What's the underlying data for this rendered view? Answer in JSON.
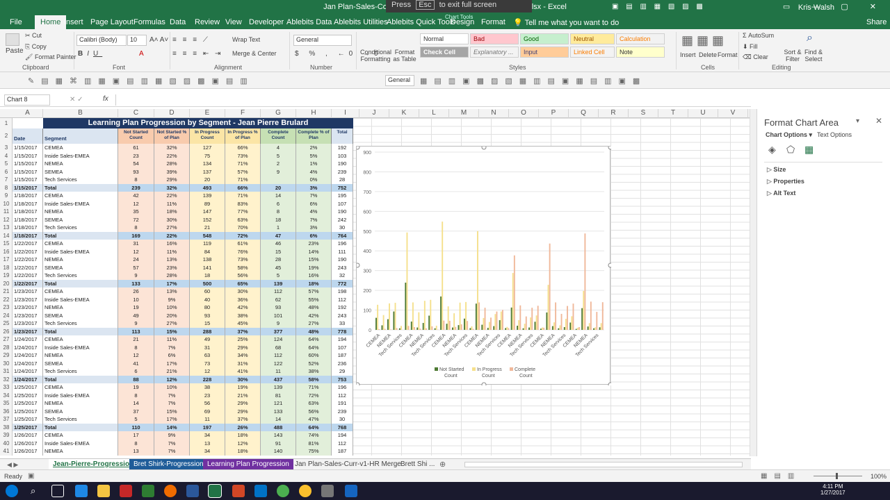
{
  "window": {
    "title": "Jan Plan-Sales-Completion Report-01-27-2017 430PM CST.xlsx  -  Excel",
    "fullscreen_hint_1": "Press",
    "fullscreen_key": "Esc",
    "fullscreen_hint_2": "to exit full screen",
    "chart_tools": "Chart Tools",
    "user": "Kris Walsh"
  },
  "tabs": [
    "File",
    "Home",
    "Insert",
    "Page Layout",
    "Formulas",
    "Data",
    "Review",
    "View",
    "Developer",
    "Ablebits Data",
    "Ablebits Utilities",
    "Ablebits Quick Tools",
    "Design",
    "Format"
  ],
  "tell_me": "Tell me what you want to do",
  "share": "Share",
  "ribbon": {
    "clipboard": {
      "paste": "Paste",
      "cut": "Cut",
      "copy": "Copy",
      "format_painter": "Format Painter",
      "label": "Clipboard"
    },
    "font": {
      "name": "Calibri (Body)",
      "size": "10",
      "label": "Font"
    },
    "alignment": {
      "wrap": "Wrap Text",
      "merge": "Merge & Center",
      "label": "Alignment"
    },
    "number": {
      "format": "General",
      "label": "Number"
    },
    "styles": {
      "cond": "Conditional Formatting",
      "fmt_table": "Format as Table",
      "normal": "Normal",
      "bad": "Bad",
      "good": "Good",
      "neutral": "Neutral",
      "calculation": "Calculation",
      "check_cell": "Check Cell",
      "explanatory": "Explanatory ...",
      "input": "Input",
      "linked_cell": "Linked Cell",
      "note": "Note",
      "label": "Styles"
    },
    "cells": {
      "insert": "Insert",
      "delete": "Delete",
      "format": "Format",
      "label": "Cells"
    },
    "editing": {
      "autosum": "AutoSum",
      "fill": "Fill",
      "clear": "Clear",
      "sort": "Sort & Filter",
      "find": "Find & Select",
      "label": "Editing"
    }
  },
  "qat2": {
    "general": "General"
  },
  "name_box": "Chart 8",
  "fx": "fx",
  "columns": [
    "A",
    "B",
    "C",
    "D",
    "E",
    "F",
    "G",
    "H",
    "I",
    "J",
    "K",
    "L",
    "M",
    "N",
    "O",
    "P",
    "Q",
    "R",
    "S",
    "T",
    "U",
    "V"
  ],
  "table": {
    "title": "Learning Plan Progression by Segment - Jean Pierre Brulard",
    "headers": [
      "Date",
      "Segment",
      "Not Started Count",
      "Not Started % of Plan",
      "In Progress Count",
      "In Progress % of Plan",
      "Complete Count",
      "Complete % of Plan",
      "Total"
    ],
    "rows": [
      [
        "1/15/2017",
        "CEMEA",
        "61",
        "32%",
        "127",
        "66%",
        "4",
        "2%",
        "192"
      ],
      [
        "1/15/2017",
        "Inside Sales-EMEA",
        "23",
        "22%",
        "75",
        "73%",
        "5",
        "5%",
        "103"
      ],
      [
        "1/15/2017",
        "NEMEA",
        "54",
        "28%",
        "134",
        "71%",
        "2",
        "1%",
        "190"
      ],
      [
        "1/15/2017",
        "SEMEA",
        "93",
        "39%",
        "137",
        "57%",
        "9",
        "4%",
        "239"
      ],
      [
        "1/15/2017",
        "Tech Services",
        "8",
        "29%",
        "20",
        "71%",
        "",
        "0%",
        "28"
      ],
      [
        "1/15/2017",
        "Total",
        "239",
        "32%",
        "493",
        "66%",
        "20",
        "3%",
        "752"
      ],
      [
        "1/18/2017",
        "CEMEA",
        "42",
        "22%",
        "139",
        "71%",
        "14",
        "7%",
        "195"
      ],
      [
        "1/18/2017",
        "Inside Sales-EMEA",
        "12",
        "11%",
        "89",
        "83%",
        "6",
        "6%",
        "107"
      ],
      [
        "1/18/2017",
        "NEMEA",
        "35",
        "18%",
        "147",
        "77%",
        "8",
        "4%",
        "190"
      ],
      [
        "1/18/2017",
        "SEMEA",
        "72",
        "30%",
        "152",
        "63%",
        "18",
        "7%",
        "242"
      ],
      [
        "1/18/2017",
        "Tech Services",
        "8",
        "27%",
        "21",
        "70%",
        "1",
        "3%",
        "30"
      ],
      [
        "1/18/2017",
        "Total",
        "169",
        "22%",
        "548",
        "72%",
        "47",
        "6%",
        "764"
      ],
      [
        "1/22/2017",
        "CEMEA",
        "31",
        "16%",
        "119",
        "61%",
        "46",
        "23%",
        "196"
      ],
      [
        "1/22/2017",
        "Inside Sales-EMEA",
        "12",
        "11%",
        "84",
        "76%",
        "15",
        "14%",
        "111"
      ],
      [
        "1/22/2017",
        "NEMEA",
        "24",
        "13%",
        "138",
        "73%",
        "28",
        "15%",
        "190"
      ],
      [
        "1/22/2017",
        "SEMEA",
        "57",
        "23%",
        "141",
        "58%",
        "45",
        "19%",
        "243"
      ],
      [
        "1/22/2017",
        "Tech Services",
        "9",
        "28%",
        "18",
        "56%",
        "5",
        "16%",
        "32"
      ],
      [
        "1/22/2017",
        "Total",
        "133",
        "17%",
        "500",
        "65%",
        "139",
        "18%",
        "772"
      ],
      [
        "1/23/2017",
        "CEMEA",
        "26",
        "13%",
        "60",
        "30%",
        "112",
        "57%",
        "198"
      ],
      [
        "1/23/2017",
        "Inside Sales-EMEA",
        "10",
        "9%",
        "40",
        "36%",
        "62",
        "55%",
        "112"
      ],
      [
        "1/23/2017",
        "NEMEA",
        "19",
        "10%",
        "80",
        "42%",
        "93",
        "48%",
        "192"
      ],
      [
        "1/23/2017",
        "SEMEA",
        "49",
        "20%",
        "93",
        "38%",
        "101",
        "42%",
        "243"
      ],
      [
        "1/23/2017",
        "Tech Services",
        "9",
        "27%",
        "15",
        "45%",
        "9",
        "27%",
        "33"
      ],
      [
        "1/23/2017",
        "Total",
        "113",
        "15%",
        "288",
        "37%",
        "377",
        "48%",
        "778"
      ],
      [
        "1/24/2017",
        "CEMEA",
        "21",
        "11%",
        "49",
        "25%",
        "124",
        "64%",
        "194"
      ],
      [
        "1/24/2017",
        "Inside Sales-EMEA",
        "8",
        "7%",
        "31",
        "29%",
        "68",
        "64%",
        "107"
      ],
      [
        "1/24/2017",
        "NEMEA",
        "12",
        "6%",
        "63",
        "34%",
        "112",
        "60%",
        "187"
      ],
      [
        "1/24/2017",
        "SEMEA",
        "41",
        "17%",
        "73",
        "31%",
        "122",
        "52%",
        "236"
      ],
      [
        "1/24/2017",
        "Tech Services",
        "6",
        "21%",
        "12",
        "41%",
        "11",
        "38%",
        "29"
      ],
      [
        "1/24/2017",
        "Total",
        "88",
        "12%",
        "228",
        "30%",
        "437",
        "58%",
        "753"
      ],
      [
        "1/25/2017",
        "CEMEA",
        "19",
        "10%",
        "38",
        "19%",
        "139",
        "71%",
        "196"
      ],
      [
        "1/25/2017",
        "Inside Sales-EMEA",
        "8",
        "7%",
        "23",
        "21%",
        "81",
        "72%",
        "112"
      ],
      [
        "1/25/2017",
        "NEMEA",
        "14",
        "7%",
        "56",
        "29%",
        "121",
        "63%",
        "191"
      ],
      [
        "1/25/2017",
        "SEMEA",
        "37",
        "15%",
        "69",
        "29%",
        "133",
        "56%",
        "239"
      ],
      [
        "1/25/2017",
        "Tech Services",
        "5",
        "17%",
        "11",
        "37%",
        "14",
        "47%",
        "30"
      ],
      [
        "1/25/2017",
        "Total",
        "110",
        "14%",
        "197",
        "26%",
        "488",
        "64%",
        "768"
      ],
      [
        "1/26/2017",
        "CEMEA",
        "17",
        "9%",
        "34",
        "18%",
        "143",
        "74%",
        "194"
      ],
      [
        "1/26/2017",
        "Inside Sales-EMEA",
        "8",
        "7%",
        "13",
        "12%",
        "91",
        "81%",
        "112"
      ],
      [
        "1/26/2017",
        "NEMEA",
        "13",
        "7%",
        "34",
        "18%",
        "140",
        "75%",
        "187"
      ]
    ]
  },
  "chart_data": {
    "type": "bar",
    "categories": [
      "CEMEA",
      "NEMEA",
      "Tech Services",
      "CEMEA",
      "NEMEA",
      "Tech Services",
      "CEMEA",
      "NEMEA",
      "Tech Services",
      "CEMEA",
      "NEMEA",
      "Tech Services",
      "CEMEA",
      "NEMEA",
      "Tech Services",
      "CEMEA",
      "NEMEA",
      "Tech Services",
      "CEMEA",
      "NEMEA",
      "Tech Services"
    ],
    "series": [
      {
        "name": "Not Started Count",
        "color": "#4e7a34",
        "values": [
          61,
          23,
          54,
          93,
          8,
          239,
          42,
          12,
          35,
          72,
          8,
          169,
          31,
          12,
          24,
          57,
          9,
          133,
          26,
          10,
          19,
          49,
          9,
          113,
          21,
          8,
          12,
          41,
          6,
          88,
          19,
          8,
          14,
          37,
          5,
          110,
          17,
          8,
          13
        ]
      },
      {
        "name": "In Progress Count",
        "color": "#f5e08c",
        "values": [
          127,
          75,
          134,
          137,
          20,
          493,
          139,
          89,
          147,
          152,
          21,
          548,
          119,
          84,
          138,
          141,
          18,
          500,
          60,
          40,
          80,
          93,
          15,
          288,
          49,
          31,
          63,
          73,
          12,
          228,
          38,
          23,
          56,
          69,
          11,
          197,
          34,
          13,
          34
        ]
      },
      {
        "name": "Complete Count",
        "color": "#f0b89a",
        "values": [
          4,
          5,
          2,
          9,
          0,
          20,
          14,
          6,
          8,
          18,
          1,
          47,
          46,
          15,
          28,
          45,
          5,
          139,
          112,
          62,
          93,
          101,
          9,
          377,
          124,
          68,
          112,
          122,
          11,
          437,
          139,
          81,
          121,
          133,
          14,
          488,
          143,
          91,
          140
        ]
      }
    ],
    "ylim": [
      0,
      900
    ],
    "yticks": [
      0,
      100,
      200,
      300,
      400,
      500,
      600,
      700,
      800,
      900
    ],
    "legend": "bottom"
  },
  "format_pane": {
    "title": "Format Chart Area",
    "chart_options": "Chart Options",
    "text_options": "Text Options",
    "sections": [
      "Size",
      "Properties",
      "Alt Text"
    ]
  },
  "sheet_tabs": [
    "Jean-Pierre-Progression",
    "Bret Shirk-Progression",
    "Learning Plan Progression",
    "Jan Plan-Sales-Curr-v1-HR Merge",
    "Brett Shi ..."
  ],
  "status": {
    "ready": "Ready",
    "zoom": "100%"
  },
  "clock": {
    "time": "4:11 PM",
    "date": "1/27/2017"
  }
}
